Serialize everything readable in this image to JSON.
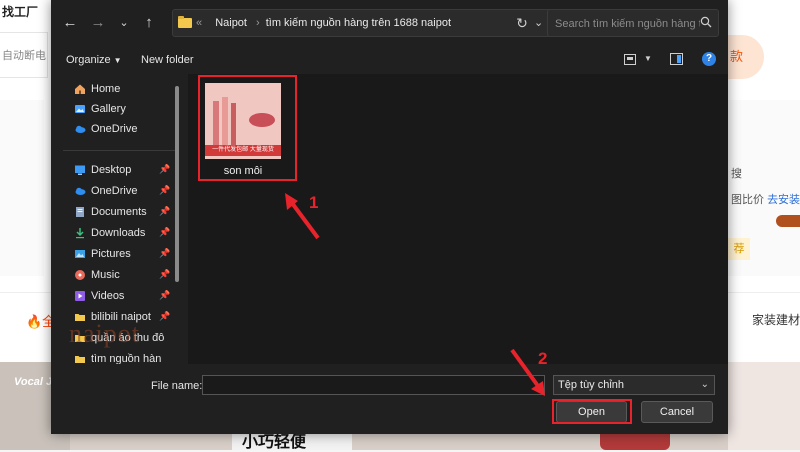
{
  "background_page": {
    "top_left_text": "找工厂",
    "search_text": "自动断电",
    "category_left": "🔥全",
    "category_right": "家装建材",
    "right_button_text": "款",
    "right_text_1": "搜",
    "right_text_2_prefix": "图比价",
    "right_text_2_link": "去安装",
    "right_tag": "荐",
    "photo_left_text": "Vocal J",
    "photo_mid_text": "小巧轻便"
  },
  "dialog": {
    "address": {
      "overflow_marker": "«",
      "crumbs": [
        "Naipot",
        "tìm kiếm nguồn hàng trên 1688 naipot"
      ]
    },
    "search": {
      "placeholder": "Search tìm kiếm nguồn hàng t..."
    },
    "toolbar": {
      "organize_label": "Organize",
      "new_folder_label": "New folder"
    },
    "nav": {
      "top_items": [
        {
          "label": "Home",
          "icon": "home-icon"
        },
        {
          "label": "Gallery",
          "icon": "gallery-icon"
        },
        {
          "label": "OneDrive",
          "icon": "cloud-icon"
        }
      ],
      "pinned_items": [
        {
          "label": "Desktop",
          "icon": "desktop-icon"
        },
        {
          "label": "OneDrive",
          "icon": "cloud-icon"
        },
        {
          "label": "Documents",
          "icon": "documents-icon"
        },
        {
          "label": "Downloads",
          "icon": "download-icon"
        },
        {
          "label": "Pictures",
          "icon": "pictures-icon"
        },
        {
          "label": "Music",
          "icon": "music-icon"
        },
        {
          "label": "Videos",
          "icon": "video-icon"
        },
        {
          "label": "bilibili naipot",
          "icon": "folder-icon"
        },
        {
          "label": "quần áo thu đô",
          "icon": "folder-icon"
        },
        {
          "label": "tìm nguồn hàn",
          "icon": "folder-icon"
        }
      ],
      "watermark": "naipot"
    },
    "files": [
      {
        "name": "son môi",
        "thumb_caption": "一件代发包邮 大量现货",
        "thumb_brand": "Bobeuttelhur"
      }
    ],
    "bottom": {
      "file_name_label": "File name:",
      "file_name_value": "",
      "file_type_value": "Tệp tùy chỉnh",
      "open_label": "Open",
      "cancel_label": "Cancel"
    }
  },
  "annotations": {
    "label_1": "1",
    "label_2": "2",
    "color": "#e8232b"
  }
}
